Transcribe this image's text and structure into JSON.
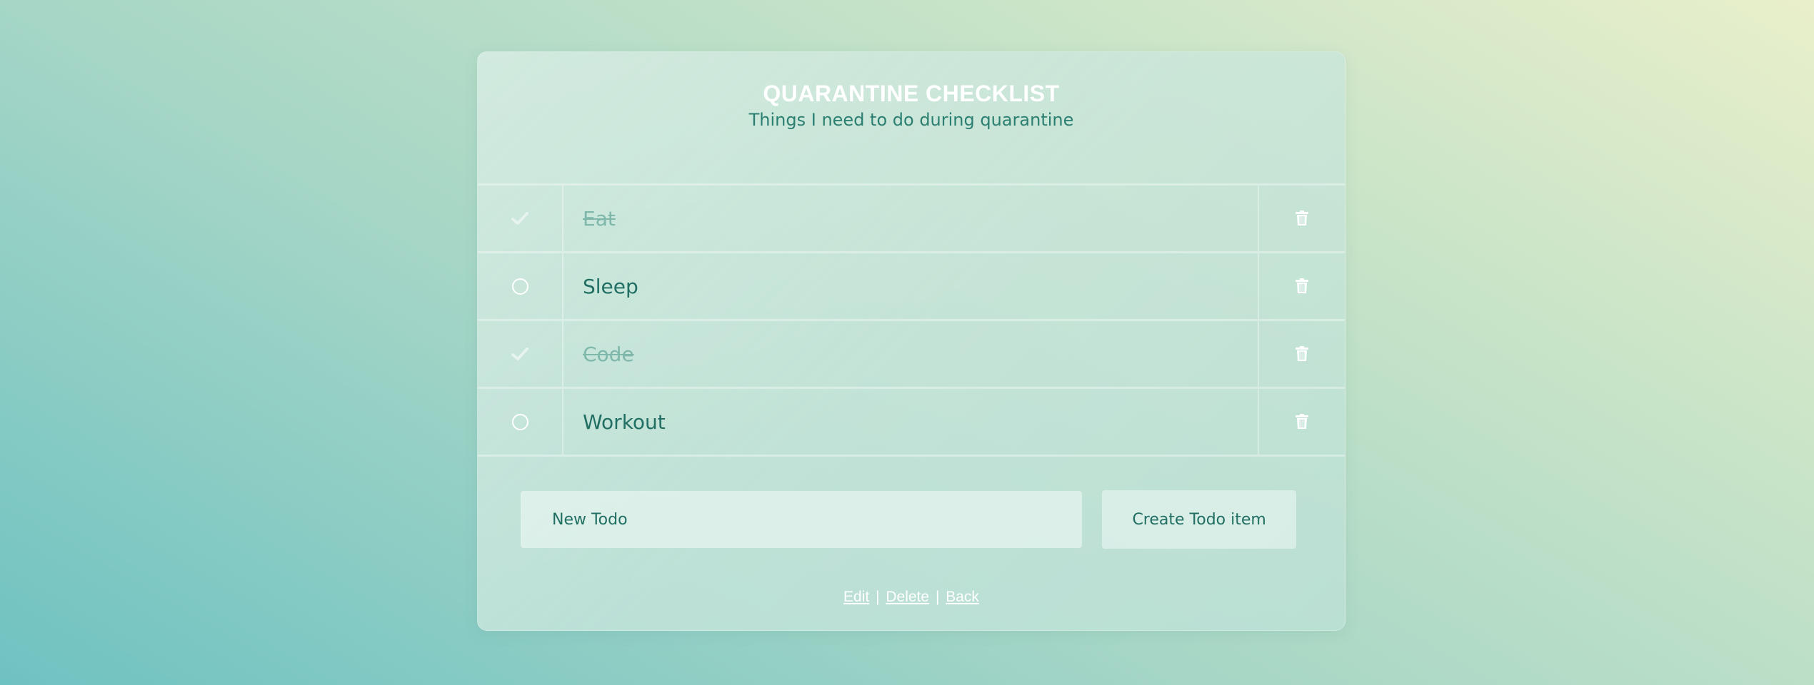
{
  "header": {
    "title": "QUARANTINE CHECKLIST",
    "subtitle": "Things I need to do during quarantine"
  },
  "todos": [
    {
      "label": "Eat",
      "done": true
    },
    {
      "label": "Sleep",
      "done": false
    },
    {
      "label": "Code",
      "done": true
    },
    {
      "label": "Workout",
      "done": false
    }
  ],
  "form": {
    "input_placeholder": "New Todo",
    "input_value": "",
    "create_label": "Create Todo item"
  },
  "footer_links": {
    "edit": "Edit",
    "delete": "Delete",
    "back": "Back",
    "separator": "|"
  },
  "icons": {
    "done": "check-icon",
    "pending": "circle-icon",
    "remove": "trash-icon"
  },
  "colors": {
    "text_primary": "#216e63",
    "text_done": "#7fb8ab",
    "title": "#ffffff"
  }
}
